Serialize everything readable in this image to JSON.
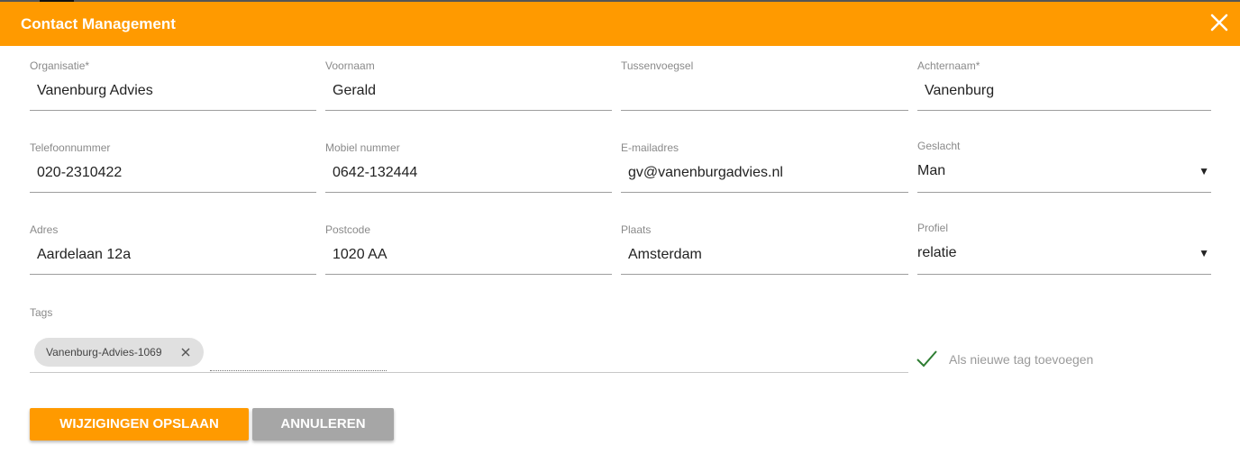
{
  "header": {
    "title": "Contact Management",
    "close_icon": "close-icon"
  },
  "form": {
    "organisatie": {
      "label": "Organisatie*",
      "value": "Vanenburg Advies"
    },
    "voornaam": {
      "label": "Voornaam",
      "value": "Gerald"
    },
    "tussenvoegsel": {
      "label": "Tussenvoegsel",
      "value": ""
    },
    "achternaam": {
      "label": "Achternaam*",
      "value": "Vanenburg"
    },
    "telefoon": {
      "label": "Telefoonnummer",
      "value": "020-2310422"
    },
    "mobiel": {
      "label": "Mobiel nummer",
      "value": "0642-132444"
    },
    "email": {
      "label": "E-mailadres",
      "value": "gv@vanenburgadvies.nl"
    },
    "geslacht": {
      "label": "Geslacht",
      "value": "Man"
    },
    "adres": {
      "label": "Adres",
      "value": "Aardelaan 12a"
    },
    "postcode": {
      "label": "Postcode",
      "value": "1020 AA"
    },
    "plaats": {
      "label": "Plaats",
      "value": "Amsterdam"
    },
    "profiel": {
      "label": "Profiel",
      "value": "relatie"
    }
  },
  "tags": {
    "label": "Tags",
    "items": [
      {
        "label": "Vanenburg-Advies-1069"
      }
    ],
    "add_new_label": "Als nieuwe tag toevoegen"
  },
  "actions": {
    "save_label": "WIJZIGINGEN OPSLAAN",
    "cancel_label": "ANNULEREN"
  },
  "colors": {
    "accent": "#ff9a00",
    "check": "#2e7d32",
    "cancel": "#a6a6a6"
  }
}
